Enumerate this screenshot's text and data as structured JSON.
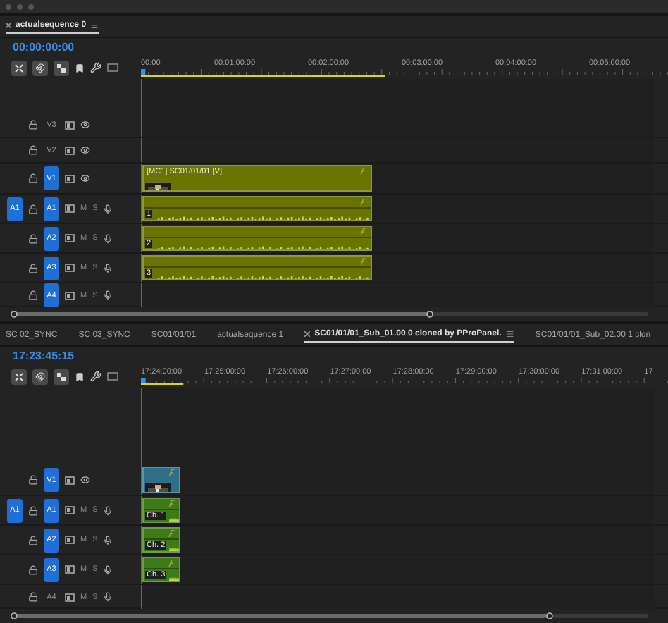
{
  "panels": [
    {
      "tabs": [
        {
          "label": "actualsequence 0",
          "selected": true
        }
      ],
      "timecode": "00:00:00:00",
      "ruler": [
        "00:00",
        "00:01:00:00",
        "00:02:00:00",
        "00:03:00:00",
        "00:04:00:00",
        "00:05:00:00"
      ],
      "tracks": [
        {
          "kind": "video",
          "name": "V3",
          "targeted": false
        },
        {
          "kind": "video",
          "name": "V2",
          "targeted": false
        },
        {
          "kind": "video",
          "name": "V1",
          "targeted": true,
          "clip": {
            "label": "[MC1] SC01/01/01 [V]",
            "thumbnail": true
          }
        },
        {
          "kind": "audio",
          "name": "A1",
          "targeted": true,
          "source_patch": "A1",
          "mute": "M",
          "solo": "S",
          "clip": {
            "label": "1"
          }
        },
        {
          "kind": "audio",
          "name": "A2",
          "targeted": true,
          "mute": "M",
          "solo": "S",
          "clip": {
            "label": "2"
          }
        },
        {
          "kind": "audio",
          "name": "A3",
          "targeted": true,
          "mute": "M",
          "solo": "S",
          "clip": {
            "label": "3"
          }
        },
        {
          "kind": "audio",
          "name": "A4",
          "targeted": true,
          "mute": "M",
          "solo": "S"
        }
      ]
    },
    {
      "tabs": [
        {
          "label": "SC 02_SYNC",
          "selected": false
        },
        {
          "label": "SC 03_SYNC",
          "selected": false
        },
        {
          "label": "SC01/01/01",
          "selected": false
        },
        {
          "label": "actualsequence 1",
          "selected": false
        },
        {
          "label": "SC01/01/01_Sub_01.00 0 cloned by PProPanel.",
          "selected": true
        },
        {
          "label": "SC01/01/01_Sub_02.00 1 clon",
          "selected": false
        }
      ],
      "timecode": "17:23:45:15",
      "ruler": [
        "17:24:00:00",
        "17:25:00:00",
        "17:26:00:00",
        "17:27:00:00",
        "17:28:00:00",
        "17:29:00:00",
        "17:30:00:00",
        "17:31:00:00",
        "17"
      ],
      "tracks": [
        {
          "kind": "video",
          "name": "V1",
          "targeted": true,
          "clip": {
            "thumbnail": true
          }
        },
        {
          "kind": "audio",
          "name": "A1",
          "targeted": true,
          "source_patch": "A1",
          "mute": "M",
          "solo": "S",
          "clip": {
            "label": "Ch. 1"
          }
        },
        {
          "kind": "audio",
          "name": "A2",
          "targeted": true,
          "mute": "M",
          "solo": "S",
          "clip": {
            "label": "Ch. 2"
          }
        },
        {
          "kind": "audio",
          "name": "A3",
          "targeted": true,
          "mute": "M",
          "solo": "S",
          "clip": {
            "label": "Ch. 3"
          }
        },
        {
          "kind": "audio",
          "name": "A4",
          "targeted": false,
          "mute": "M",
          "solo": "S"
        }
      ]
    }
  ]
}
